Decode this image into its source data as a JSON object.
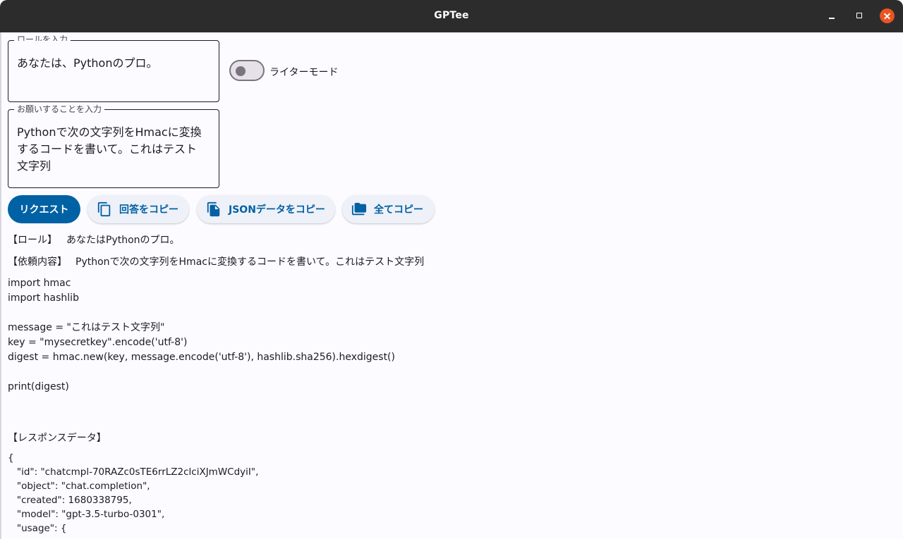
{
  "window": {
    "title": "GPTee"
  },
  "role_field": {
    "legend": "ロールを入力",
    "value": "あなたは、Pythonのプロ。"
  },
  "request_field": {
    "legend": "お願いすることを入力",
    "value": "Pythonで次の文字列をHmacに変換\nするコードを書いて。これはテスト\n文字列"
  },
  "writer_mode": {
    "label": "ライターモード",
    "enabled": false
  },
  "buttons": {
    "request": "リクエスト",
    "copy_answer": "回答をコピー",
    "copy_json": "JSONデータをコピー",
    "copy_all": "全てコピー"
  },
  "result": {
    "role_label": "【ロール】",
    "role_value": "あなたはPythonのプロ。",
    "request_label": "【依頼内容】",
    "request_value": "Pythonで次の文字列をHmacに変換するコードを書いて。これはテスト文字列",
    "code": "import hmac\nimport hashlib\n\nmessage = \"これはテスト文字列\"\nkey = \"mysecretkey\".encode('utf-8')\ndigest = hmac.new(key, message.encode('utf-8'), hashlib.sha256).hexdigest()\n\nprint(digest)",
    "response_label": "【レスポンスデータ】",
    "response_json": "{\n   \"id\": \"chatcmpl-70RAZc0sTE6rrLZ2clciXJmWCdyiI\",\n   \"object\": \"chat.completion\",\n   \"created\": 1680338795,\n   \"model\": \"gpt-3.5-turbo-0301\",\n   \"usage\": {"
  },
  "colors": {
    "primary": "#0061a4",
    "tonal_bg": "#eff1f8",
    "titlebar": "#2c2c2c",
    "close": "#e95420",
    "background": "#fcfbff"
  },
  "icons": {
    "copy_answer": "copy-icon",
    "copy_json": "file-copy-icon",
    "copy_all": "folder-copy-icon"
  }
}
